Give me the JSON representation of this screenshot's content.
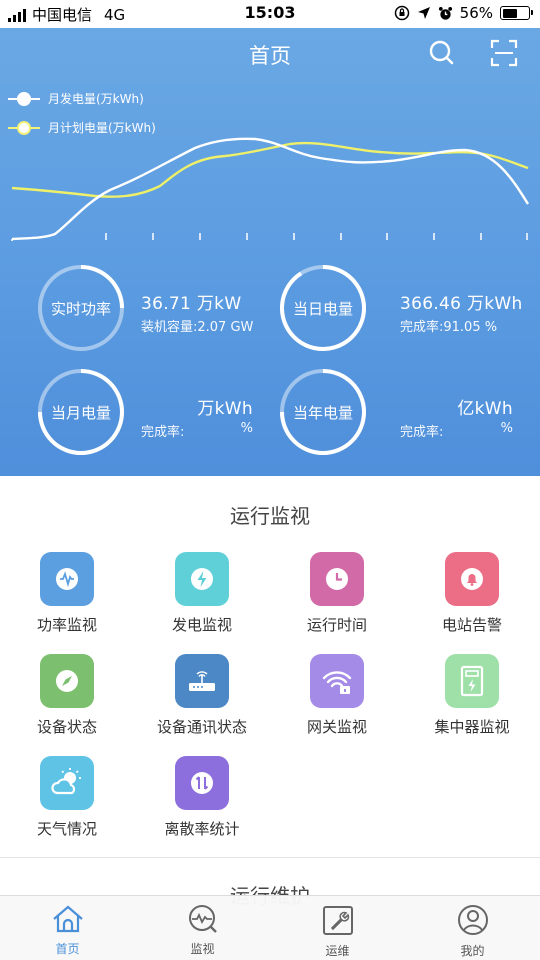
{
  "status_bar": {
    "carrier": "中国电信",
    "network": "4G",
    "time": "15:03",
    "battery": "56%",
    "battery_level": 0.56
  },
  "header": {
    "title": "首页",
    "icons": [
      "search-icon",
      "scan-icon"
    ]
  },
  "chart_data": {
    "type": "line",
    "series": [
      {
        "name": "月发电量(万kWh)",
        "color": "#ffffff"
      },
      {
        "name": "月计划电量(万kWh)",
        "color": "#f2f27a"
      }
    ]
  },
  "stats": [
    {
      "label": "实时功率",
      "value": "36.71 万kW",
      "sub": "装机容量:2.07 GW"
    },
    {
      "label": "当日电量",
      "value": "366.46 万kWh",
      "sub": "完成率:91.05 %"
    },
    {
      "label": "当月电量",
      "value": "万kWh",
      "sub_label": "完成率:",
      "sub_unit": "%"
    },
    {
      "label": "当年电量",
      "value": "亿kWh",
      "sub_label": "完成率:",
      "sub_unit": "%"
    }
  ],
  "section": {
    "title": "运行监视",
    "items": [
      {
        "label": "功率监视",
        "icon": "pulse-icon",
        "color": "#5b9fe0"
      },
      {
        "label": "发电监视",
        "icon": "lightning-icon",
        "color": "#5fcfd8"
      },
      {
        "label": "运行时间",
        "icon": "clock-icon",
        "color": "#d26aa7"
      },
      {
        "label": "电站告警",
        "icon": "bell-icon",
        "color": "#eb6e86"
      },
      {
        "label": "设备状态",
        "icon": "compass-icon",
        "color": "#7cbf6e"
      },
      {
        "label": "设备通讯状态",
        "icon": "router-icon",
        "color": "#4c88c6"
      },
      {
        "label": "网关监视",
        "icon": "wifi-lock-icon",
        "color": "#a58be8"
      },
      {
        "label": "集中器监视",
        "icon": "meter-icon",
        "color": "#9fe0a8"
      },
      {
        "label": "天气情况",
        "icon": "weather-icon",
        "color": "#5fc3e6"
      },
      {
        "label": "离散率统计",
        "icon": "discrete-icon",
        "color": "#8c6fdc"
      }
    ]
  },
  "section2": {
    "title": "运行维护"
  },
  "tabbar": {
    "items": [
      {
        "label": "首页",
        "icon": "home-icon",
        "active": true
      },
      {
        "label": "监视",
        "icon": "monitor-icon",
        "active": false
      },
      {
        "label": "运维",
        "icon": "maintenance-icon",
        "active": false
      },
      {
        "label": "我的",
        "icon": "profile-icon",
        "active": false
      }
    ]
  }
}
